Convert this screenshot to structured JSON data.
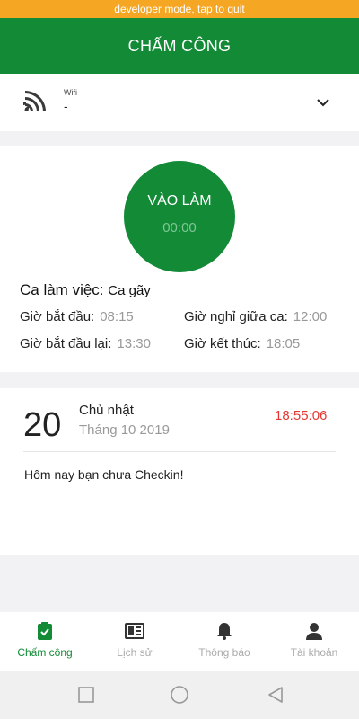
{
  "dev_banner": "developer mode, tap to quit",
  "app_title": "CHẤM CÔNG",
  "wifi": {
    "label": "Wifi",
    "value": "-"
  },
  "checkin": {
    "label": "VÀO LÀM",
    "timer": "00:00"
  },
  "shift": {
    "title": "Ca làm việc:",
    "name": "Ca gãy",
    "start_label": "Giờ bắt đầu:",
    "start_value": "08:15",
    "break_label": "Giờ nghỉ giữa ca:",
    "break_value": "12:00",
    "restart_label": "Giờ bắt đầu lại:",
    "restart_value": "13:30",
    "end_label": "Giờ kết thúc:",
    "end_value": "18:05"
  },
  "today": {
    "day": "20",
    "weekday": "Chủ nhật",
    "month": "Tháng 10 2019",
    "clock": "18:55:06",
    "message": "Hôm nay bạn chưa Checkin!"
  },
  "nav": {
    "items": [
      {
        "label": "Chấm công",
        "icon": "clipboard-check-icon",
        "active": true
      },
      {
        "label": "Lịch sử",
        "icon": "newspaper-icon",
        "active": false
      },
      {
        "label": "Thông báo",
        "icon": "bell-icon",
        "active": false
      },
      {
        "label": "Tài khoản",
        "icon": "person-icon",
        "active": false
      }
    ]
  },
  "colors": {
    "brand": "#128a36",
    "warning_bar": "#f5a623",
    "clock": "#e53935",
    "muted": "#999999"
  }
}
